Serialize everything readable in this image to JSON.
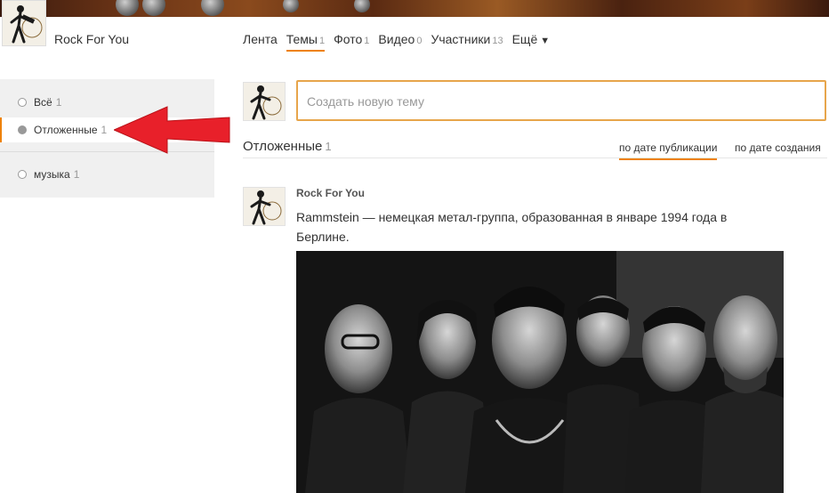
{
  "group": {
    "name": "Rock For You"
  },
  "nav": {
    "tabs": [
      {
        "label": "Лента",
        "count": ""
      },
      {
        "label": "Темы",
        "count": "1"
      },
      {
        "label": "Фото",
        "count": "1"
      },
      {
        "label": "Видео",
        "count": "0"
      },
      {
        "label": "Участники",
        "count": "13"
      },
      {
        "label": "Ещё",
        "count": ""
      }
    ],
    "more_caret": "▼"
  },
  "sidebar": {
    "items": [
      {
        "label": "Всё",
        "count": "1"
      },
      {
        "label": "Отложенные",
        "count": "1"
      },
      {
        "label": "музыка",
        "count": "1"
      }
    ]
  },
  "composer": {
    "placeholder": "Создать новую тему"
  },
  "section": {
    "title": "Отложенные",
    "count": "1",
    "sort_by_publication": "по дате публикации",
    "sort_by_creation": "по дате создания"
  },
  "post": {
    "author": "Rock For You",
    "text": "Rammstein — немецкая метал-группа, образованная в январе 1994 года в Берлине."
  },
  "colors": {
    "accent": "#ee8208",
    "composer_border": "#e7a54b",
    "arrow": "#e8202a",
    "sidebar_bg": "#f0f0f0"
  }
}
